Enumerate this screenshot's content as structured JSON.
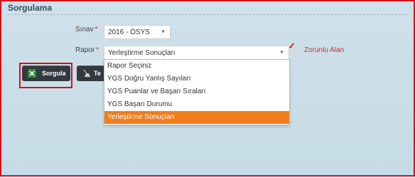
{
  "panel": {
    "title": "Sorgulama"
  },
  "fields": {
    "sinav": {
      "label": "Sınav",
      "required_mark": "*",
      "value": "2016 - ÖSYS"
    },
    "rapor": {
      "label": "Rapor",
      "required_mark": "*",
      "value": "Yerleştirme Sonuçları"
    }
  },
  "required_note": "Zorunlu Alan",
  "buttons": {
    "sorgula": "Sorgula",
    "temizle_partial": "Te"
  },
  "dropdown": {
    "options": [
      "Rapor Seçiniz",
      "YGS Doğru Yanlış Sayıları",
      "YGS Puanlar ve Başarı Sıraları",
      "YGS Başarı Durumu",
      "Yerleştirme Sonuçları"
    ],
    "selected_index": 4
  },
  "colors": {
    "highlight_border": "#d0101b",
    "selected_option": "#f07d1e",
    "button_bg": "#333a3f",
    "panel_bg": "#cfe1ea"
  },
  "icons": {
    "select_caret": "chevron-down-icon",
    "required": "pencil-icon",
    "sorgula": "excel-icon",
    "temizle": "broom-icon"
  }
}
